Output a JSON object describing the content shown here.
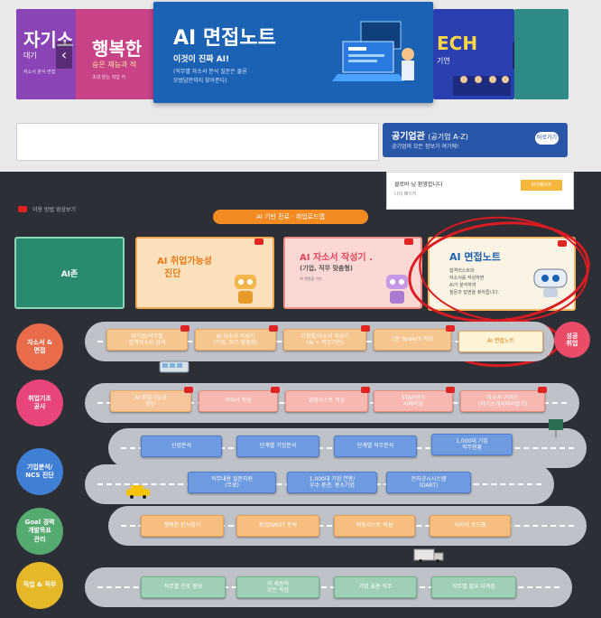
{
  "banners": [
    {
      "title": "자기소",
      "sub": "대기",
      "desc": "자소서 분석·면접",
      "color": "#8a44b6"
    },
    {
      "title": "행복한",
      "sub": "승은 재능과 적",
      "desc": "초대 받는 직업 커",
      "color": "#c84286"
    },
    {
      "title": "AI 면접노트",
      "sub": "이것이 진짜 AI!",
      "desc1": "(직무별 자소서 분석 질문은 물론",
      "desc2": "모범답안까지 찾아준다)",
      "color": "#1b62b5"
    },
    {
      "title": "ECH",
      "sub": "기연",
      "color": "#2a3fb0"
    },
    {
      "title": "",
      "sub": "",
      "color": "#2e8a84"
    }
  ],
  "public_org": {
    "title": "공기업관",
    "title_sub": "(공기업 A-Z)",
    "desc": "공기업의 모든 정보가 여기에!",
    "btn": "바로가기"
  },
  "notice": {
    "line1": "클로바 님 환영합니다",
    "line2": "나의 페이지",
    "btn": "마이페이지"
  },
  "youtube_label": "이용 방법 영상보기",
  "roadmap_title": "AI 기반 진로 · 취업로드맵",
  "top_boxes": {
    "ai_zone": "AI존",
    "readiness": {
      "title": "AI 취업가능성",
      "title2": "진단"
    },
    "resume": {
      "title": "AI 자소서 작성기 .",
      "sub": "(기업, 직무 맞춤형)",
      "small": "AI 챗봇을 기반"
    },
    "interview": {
      "title": "AI 면접노트",
      "desc1": "합격리스트와",
      "desc2": "자소서를 작성하면",
      "desc3": "AI가 분석하여",
      "desc4": "질문과 답변을 찾아줍니다."
    }
  },
  "categories": [
    {
      "label": "자소서 &\n면접",
      "color": "#e86b4a"
    },
    {
      "label": "취업기초\n공사",
      "color": "#e8457d"
    },
    {
      "label": "기업분석/\nNCS 진단",
      "color": "#3f7fd6"
    },
    {
      "label": "Goal 경력\n개발목표\n관리",
      "color": "#55aa70"
    },
    {
      "label": "직업 & 직무",
      "color": "#e5b829"
    }
  ],
  "row1": [
    "대기업/직무별\n합격자소서 검색",
    "AI 자소서 작성기\n(기업, 직무 맞춤형)",
    "기획별/자소서 작성기\n(AI + 직무기반)",
    "1분 Speech 작성",
    "AI 면접노트"
  ],
  "row2": [
    "AI 취업가능성\n진단",
    "이력서 작성",
    "경험리스트 작성",
    "STAR방식\n사례작성",
    "자소서 가이드\n(자기소개서따라잡기)"
  ],
  "row3": [
    "산업분석",
    "단계별 기업분석",
    "단계별 직무분석",
    "1,000대 기업\n직무현황"
  ],
  "row3b": [
    "직무내용 질문지원\n(무료)",
    "1,000대 기업 연봉/\n우수 중견, 중소기업",
    "전자공시시스템\n(DART)"
  ],
  "row4": [
    "행복한 인식찾기",
    "취업SWOT 분석",
    "버킷리스트 작성",
    "커리어 로드맵"
  ],
  "row5": [
    "직무별 진로 정보",
    "이 세상의\n모든 직업",
    "기업 표준 직무",
    "직무별 필요 자격증"
  ],
  "success": "성공\n취업"
}
